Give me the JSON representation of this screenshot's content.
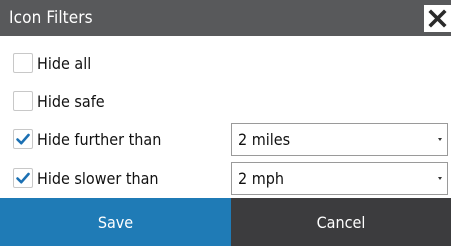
{
  "dialog": {
    "title": "Icon Filters",
    "close_icon": "close-x-icon"
  },
  "filters": [
    {
      "label": "Hide all",
      "checked": false
    },
    {
      "label": "Hide safe",
      "checked": false
    },
    {
      "label": "Hide further than",
      "checked": true,
      "value": "2 miles"
    },
    {
      "label": "Hide slower than",
      "checked": true,
      "value": "2 mph"
    }
  ],
  "footer": {
    "save_label": "Save",
    "cancel_label": "Cancel"
  },
  "colors": {
    "titlebar": "#58595b",
    "save_button": "#1f7bb6",
    "cancel_button": "#3c3c3e",
    "checkmark": "#1b70b3"
  }
}
